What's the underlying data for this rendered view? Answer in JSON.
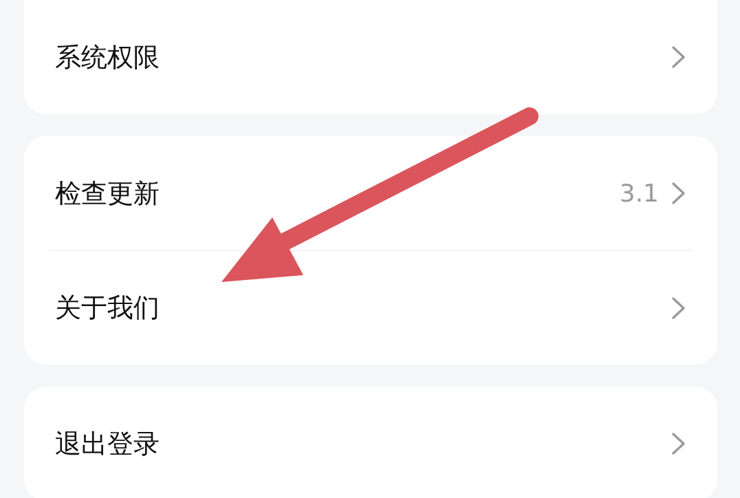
{
  "groups": [
    {
      "items": [
        {
          "label": "系统权限"
        }
      ]
    },
    {
      "items": [
        {
          "label": "检查更新",
          "value": "3.1"
        },
        {
          "label": "关于我们"
        }
      ]
    },
    {
      "items": [
        {
          "label": "退出登录"
        }
      ]
    }
  ]
}
